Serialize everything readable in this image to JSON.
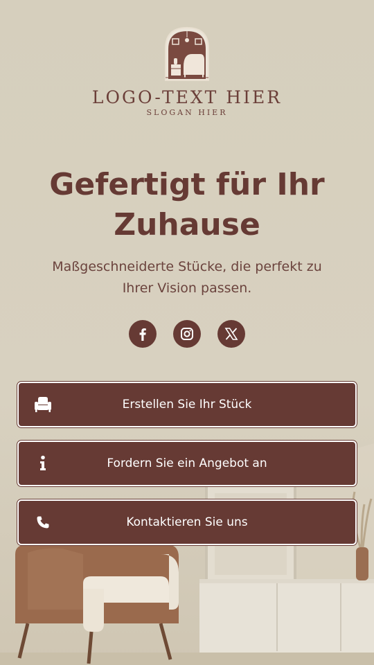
{
  "logo": {
    "text": "LOGO-TEXT HIER",
    "slogan": "SLOGAN HIER",
    "icon": "armchair-room-logo-icon"
  },
  "hero": {
    "title": "Gefertigt für Ihr Zuhause",
    "subtitle": "Maßgeschneiderte Stücke, die perfekt zu Ihrer Vision passen."
  },
  "socials": [
    {
      "name": "facebook",
      "icon": "facebook-icon"
    },
    {
      "name": "instagram",
      "icon": "instagram-icon"
    },
    {
      "name": "x",
      "icon": "x-icon"
    }
  ],
  "buttons": [
    {
      "label": "Erstellen Sie Ihr Stück",
      "icon": "armchair-icon"
    },
    {
      "label": "Fordern Sie ein Angebot an",
      "icon": "info-icon"
    },
    {
      "label": "Kontaktieren Sie uns",
      "icon": "phone-icon"
    }
  ],
  "colors": {
    "background": "#d6cfbd",
    "brand": "#663a34",
    "button_text": "#ffffff"
  }
}
